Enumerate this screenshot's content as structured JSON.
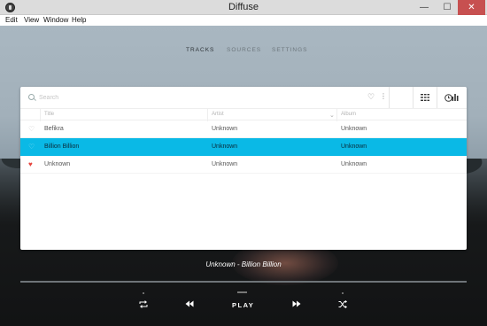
{
  "window": {
    "title": "Diffuse",
    "minimize": "—",
    "maximize": "☐",
    "close": "✕"
  },
  "menu": [
    "Edit",
    "View",
    "Window",
    "Help"
  ],
  "nav": {
    "tabs": [
      "TRACKS",
      "SOURCES",
      "SETTINGS"
    ],
    "active_index": 0
  },
  "search": {
    "placeholder": "Search",
    "value": ""
  },
  "table": {
    "columns": [
      "Title",
      "Artist",
      "Album"
    ],
    "rows": [
      {
        "title": "Befikra",
        "artist": "Unknown",
        "album": "Unknown",
        "favorite": false,
        "selected": false
      },
      {
        "title": "Billion Billion",
        "artist": "Unknown",
        "album": "Unknown",
        "favorite": false,
        "selected": true
      },
      {
        "title": "Unknown",
        "artist": "Unknown",
        "album": "Unknown",
        "favorite": true,
        "selected": false
      }
    ]
  },
  "player": {
    "now_playing": "Unknown - Billion Billion",
    "play_label": "PLAY",
    "progress": 0
  },
  "icons": {
    "favorite_filter": "heart-outline-icon",
    "more": "more-vertical-icon",
    "layout": "grid-icon",
    "history": "clock-icon",
    "stats": "bar-chart-icon",
    "repeat": "repeat-icon",
    "previous": "rewind-icon",
    "next": "fast-forward-icon",
    "shuffle": "shuffle-icon"
  },
  "colors": {
    "selection": "#0ab9e6",
    "favorite": "#e6443d",
    "close_button": "#c75050"
  }
}
